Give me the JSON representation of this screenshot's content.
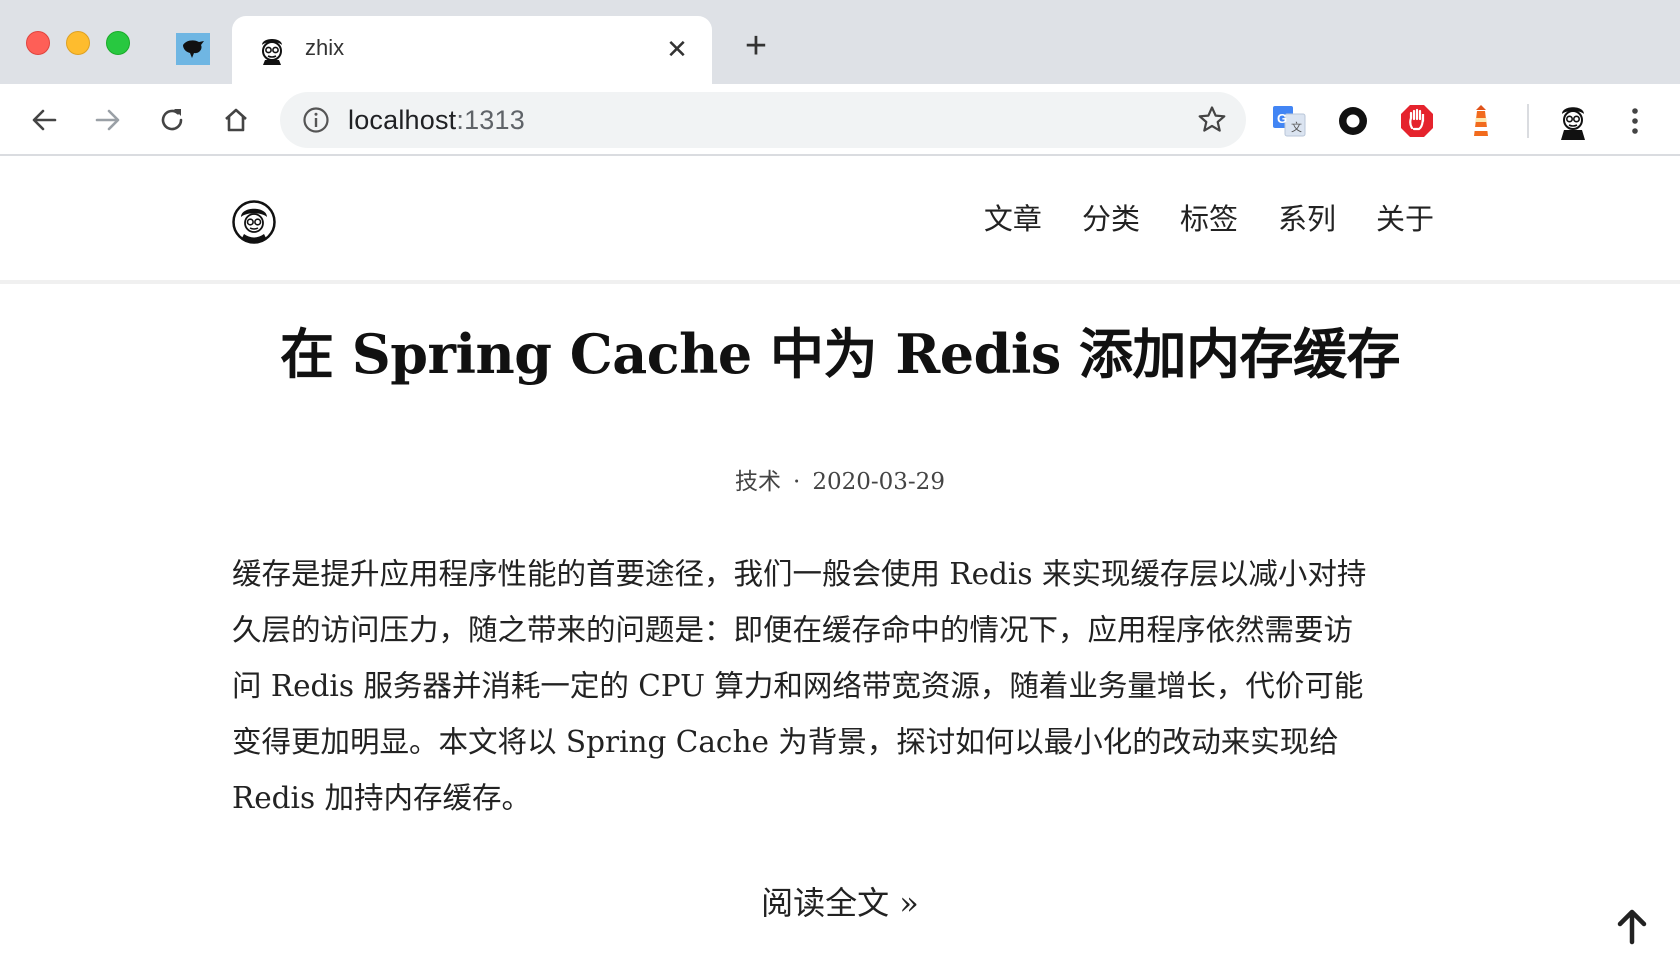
{
  "browser": {
    "tab": {
      "title": "zhix",
      "close_glyph": "✕"
    },
    "new_tab_glyph": "+",
    "address": {
      "host": "localhost",
      "port": ":1313"
    },
    "icons": {
      "back": "arrow-left-icon",
      "forward": "arrow-right-icon",
      "reload": "reload-icon",
      "home": "home-icon",
      "info": "info-icon",
      "bookmark": "star-icon",
      "translate": "google-translate-icon",
      "ext_circle": "circle-extension-icon",
      "ext_adblock": "adblock-hand-icon",
      "ext_lighthouse": "lighthouse-icon",
      "profile": "profile-avatar-icon",
      "menu": "vertical-dots-menu-icon"
    },
    "colors": {
      "tabbar": "#dee1e6",
      "omnibox": "#f1f3f4",
      "adblock": "#e5232d",
      "lighthouse": "#f26b1d"
    }
  },
  "site": {
    "nav": [
      {
        "label": "文章"
      },
      {
        "label": "分类"
      },
      {
        "label": "标签"
      },
      {
        "label": "系列"
      },
      {
        "label": "关于"
      }
    ]
  },
  "post": {
    "title": "在 Spring Cache 中为 Redis 添加内存缓存",
    "category": "技术",
    "separator": "·",
    "date": "2020-03-29",
    "excerpt_lines": [
      "缓存是提升应用程序性能的首要途径，我们一般会使用 Redis 来实现缓存层以减小对持",
      "久层的访问压力，随之带来的问题是：即便在缓存命中的情况下，应用程序依然需要访",
      "问 Redis 服务器并消耗一定的 CPU 算力和网络带宽资源，随着业务量增长，代价可能",
      "变得更加明显。本文将以 Spring Cache 为背景，探讨如何以最小化的改动来实现给",
      "Redis 加持内存缓存。"
    ],
    "read_more": "阅读全文 »"
  },
  "back_to_top_icon": "arrow-up-icon"
}
